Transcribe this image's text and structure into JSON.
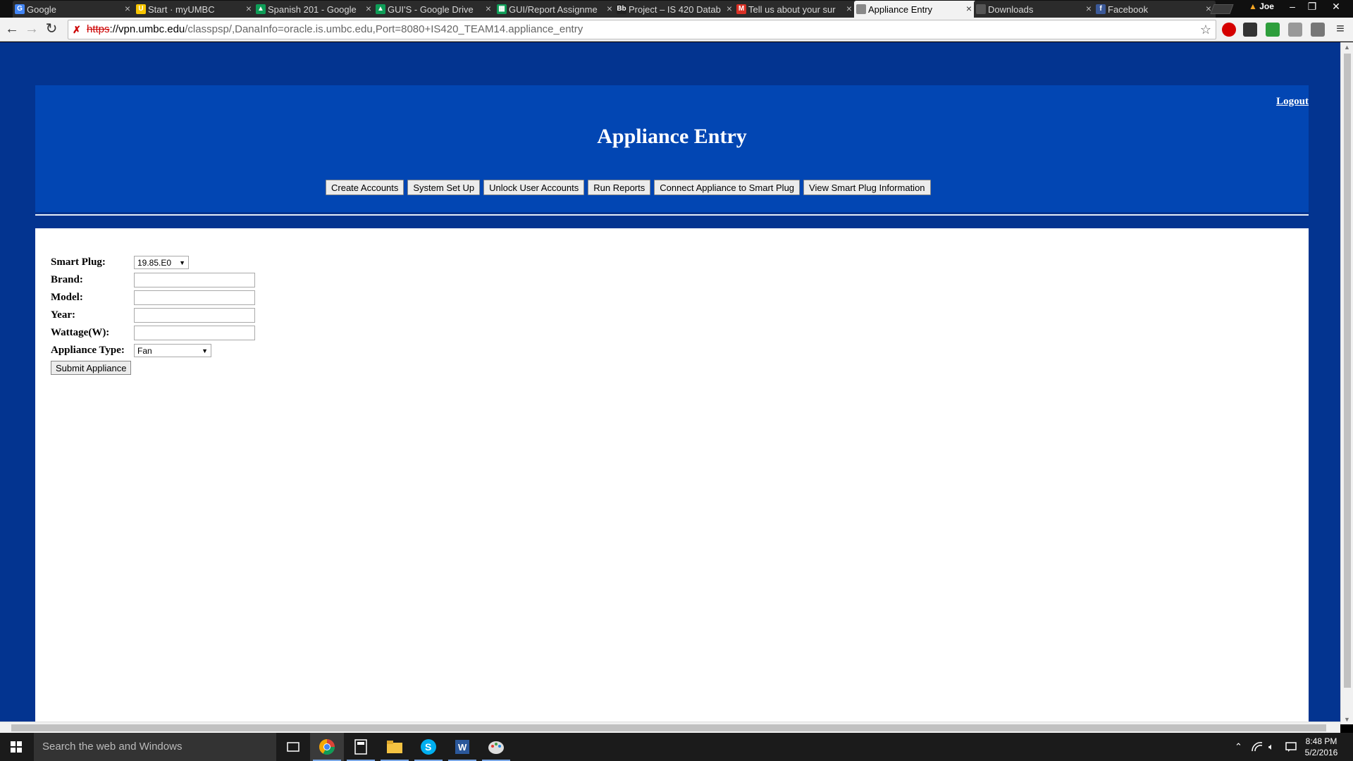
{
  "browser": {
    "tabs": [
      {
        "label": "Google",
        "favicon_color": "#4285f4",
        "favicon_glyph": "G",
        "active": false
      },
      {
        "label": "Start · myUMBC",
        "favicon_color": "#f7c500",
        "favicon_glyph": "U",
        "active": false
      },
      {
        "label": "Spanish 201 - Google",
        "favicon_color": "#0f9d58",
        "favicon_glyph": "▲",
        "active": false
      },
      {
        "label": "GUI'S - Google Drive",
        "favicon_color": "#0f9d58",
        "favicon_glyph": "▲",
        "active": false
      },
      {
        "label": "GUI/Report Assignme",
        "favicon_color": "#0f9d58",
        "favicon_glyph": "▦",
        "active": false
      },
      {
        "label": "Project – IS 420 Datab",
        "favicon_color": "#222222",
        "favicon_glyph": "Bb",
        "active": false
      },
      {
        "label": "Tell us about your sur",
        "favicon_color": "#d93025",
        "favicon_glyph": "M",
        "active": false
      },
      {
        "label": "Appliance Entry",
        "favicon_color": "#888888",
        "favicon_glyph": "",
        "active": true
      },
      {
        "label": "Downloads",
        "favicon_color": "#555555",
        "favicon_glyph": "",
        "active": false
      },
      {
        "label": "Facebook",
        "favicon_color": "#3b5998",
        "favicon_glyph": "f",
        "active": false
      }
    ],
    "profile_name": "Joe",
    "url_scheme": "https",
    "url_host": "://vpn.umbc.edu",
    "url_path": "/classpsp/,DanaInfo=oracle.is.umbc.edu,Port=8080+IS420_TEAM14.appliance_entry"
  },
  "page": {
    "logout_label": "Logout",
    "title": "Appliance Entry",
    "nav_buttons": [
      "Create Accounts",
      "System Set Up",
      "Unlock User Accounts",
      "Run Reports",
      "Connect Appliance to Smart Plug",
      "View Smart Plug Information"
    ],
    "form": {
      "smart_plug_label": "Smart Plug:",
      "smart_plug_value": "19.85.E0",
      "brand_label": "Brand:",
      "brand_value": "",
      "model_label": "Model:",
      "model_value": "",
      "year_label": "Year:",
      "year_value": "",
      "wattage_label": "Wattage(W):",
      "wattage_value": "",
      "appliance_type_label": "Appliance Type:",
      "appliance_type_value": "Fan",
      "submit_label": "Submit Appliance"
    },
    "colors": {
      "background": "#033490",
      "header": "#0246b3"
    }
  },
  "taskbar": {
    "search_placeholder": "Search the web and Windows",
    "time": "8:48 PM",
    "date": "5/2/2016"
  }
}
